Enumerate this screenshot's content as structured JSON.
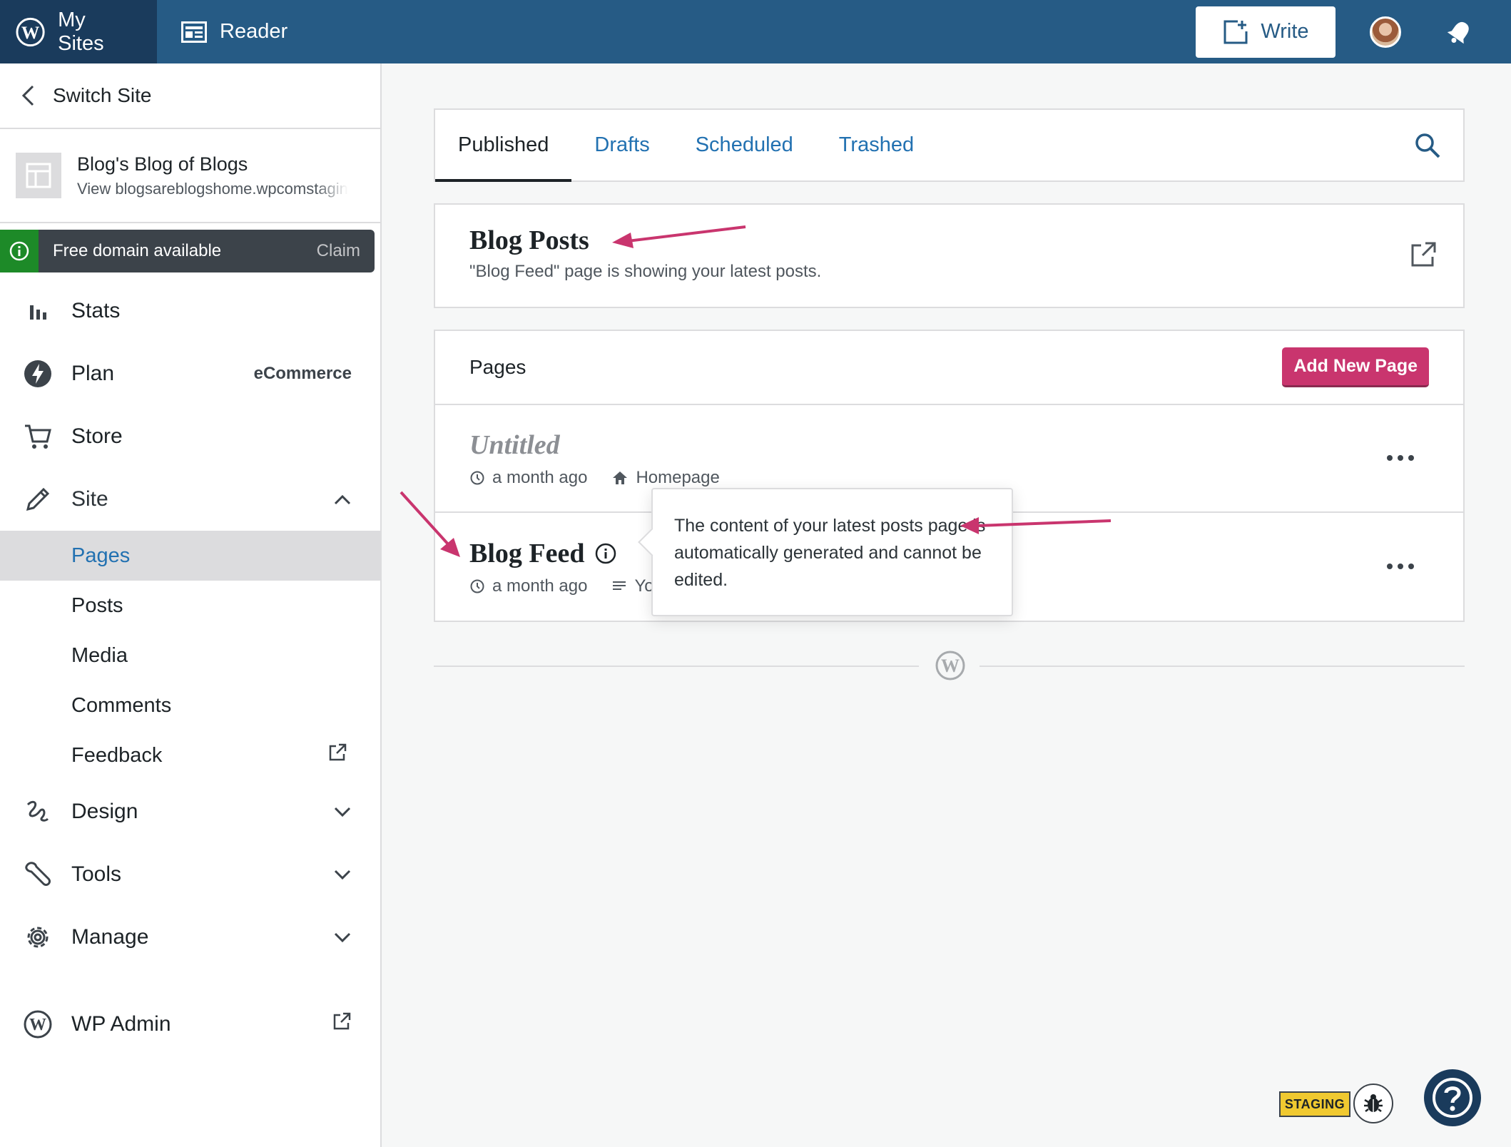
{
  "masterbar": {
    "my_sites": "My Sites",
    "reader": "Reader",
    "write": "Write"
  },
  "sidebar": {
    "switch_site": "Switch Site",
    "site_title": "Blog's Blog of Blogs",
    "site_url": "View blogsareblogshome.wpcomstaging.com",
    "domain_banner": {
      "text": "Free domain available",
      "action": "Claim"
    },
    "nav": {
      "stats": "Stats",
      "plan": "Plan",
      "plan_meta": "eCommerce",
      "store": "Store",
      "site": "Site",
      "pages": "Pages",
      "posts": "Posts",
      "media": "Media",
      "comments": "Comments",
      "feedback": "Feedback",
      "design": "Design",
      "tools": "Tools",
      "manage": "Manage",
      "wp_admin": "WP Admin"
    }
  },
  "main": {
    "tabs": [
      "Published",
      "Drafts",
      "Scheduled",
      "Trashed"
    ],
    "blog_posts": {
      "title": "Blog Posts",
      "subtitle": "\"Blog Feed\" page is showing your latest posts."
    },
    "pages": {
      "header": "Pages",
      "add_button": "Add New Page",
      "rows": [
        {
          "title": "Untitled",
          "time": "a month ago",
          "badge": "Homepage"
        },
        {
          "title": "Blog Feed",
          "time": "a month ago",
          "badge": "Yo"
        }
      ]
    },
    "tooltip": "The content of your latest posts page is automatically generated and cannot be edited."
  },
  "badges": {
    "staging": "STAGING"
  },
  "colors": {
    "masterbar": "#265b85",
    "accent_pink": "#c9356e",
    "link_blue": "#2271b1",
    "domain_green": "#1d8a28",
    "staging_yellow": "#f0c930"
  }
}
